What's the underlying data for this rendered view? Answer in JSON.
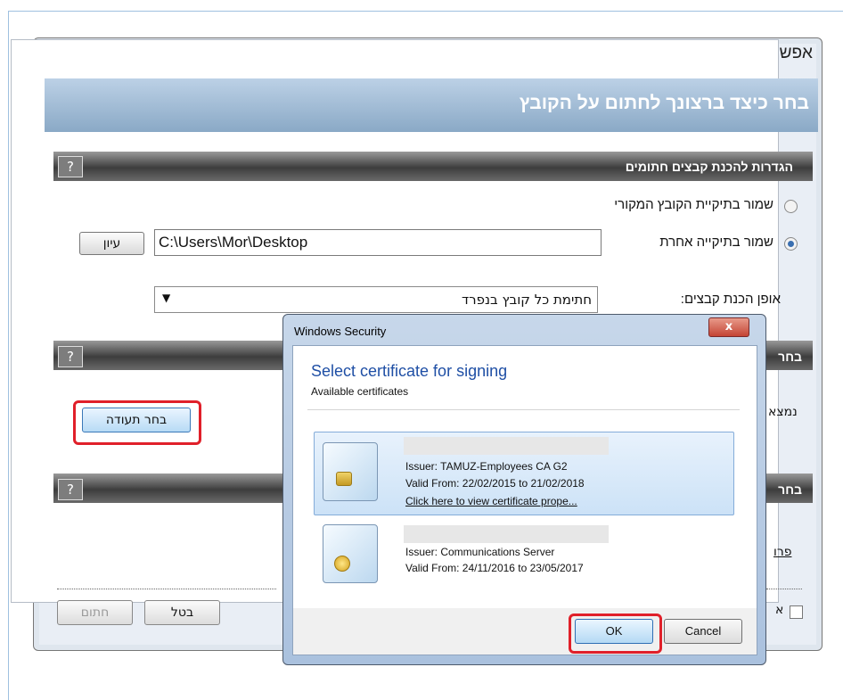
{
  "main_window": {
    "title": "אפשרויות חתימה",
    "close_label": "☒",
    "banner": "בחר כיצד ברצונך לחתום על הקובץ"
  },
  "section_prepare": {
    "help_label": "?",
    "title": "הגדרות להכנת קבצים חתומים",
    "radio_original": "שמור בתיקיית הקובץ המקורי",
    "radio_other": "שמור בתיקייה אחרת",
    "path_value": "C:\\Users\\Mor\\Desktop",
    "browse_label": "עיון",
    "method_label": "אופן הכנת קבצים:",
    "method_value": "חתימת כל קובץ בנפרד",
    "combo_arrow": "▼"
  },
  "section_cert": {
    "help_label": "?",
    "title_fragment": "בחר",
    "found_fragment": "נמצא",
    "choose_cert_label": "בחר תעודה"
  },
  "section_third": {
    "help_label": "?",
    "title_fragment": "בחר",
    "details_fragment": "פרו"
  },
  "bottom": {
    "cancel_label": "בטל",
    "sign_label": "חתום",
    "check_fragment": "א"
  },
  "security_dialog": {
    "title": "Windows Security",
    "close_label": "x",
    "heading": "Select certificate for signing",
    "subheading": "Available certificates",
    "certificates": [
      {
        "issuer": "Issuer: TAMUZ-Employees CA G2",
        "valid": "Valid From: 22/02/2015 to 21/02/2018",
        "link": "Click here to view certificate prope..."
      },
      {
        "issuer": "Issuer: Communications Server",
        "valid": "Valid From: 24/11/2016 to 23/05/2017"
      }
    ],
    "ok_label": "OK",
    "cancel_label": "Cancel"
  }
}
